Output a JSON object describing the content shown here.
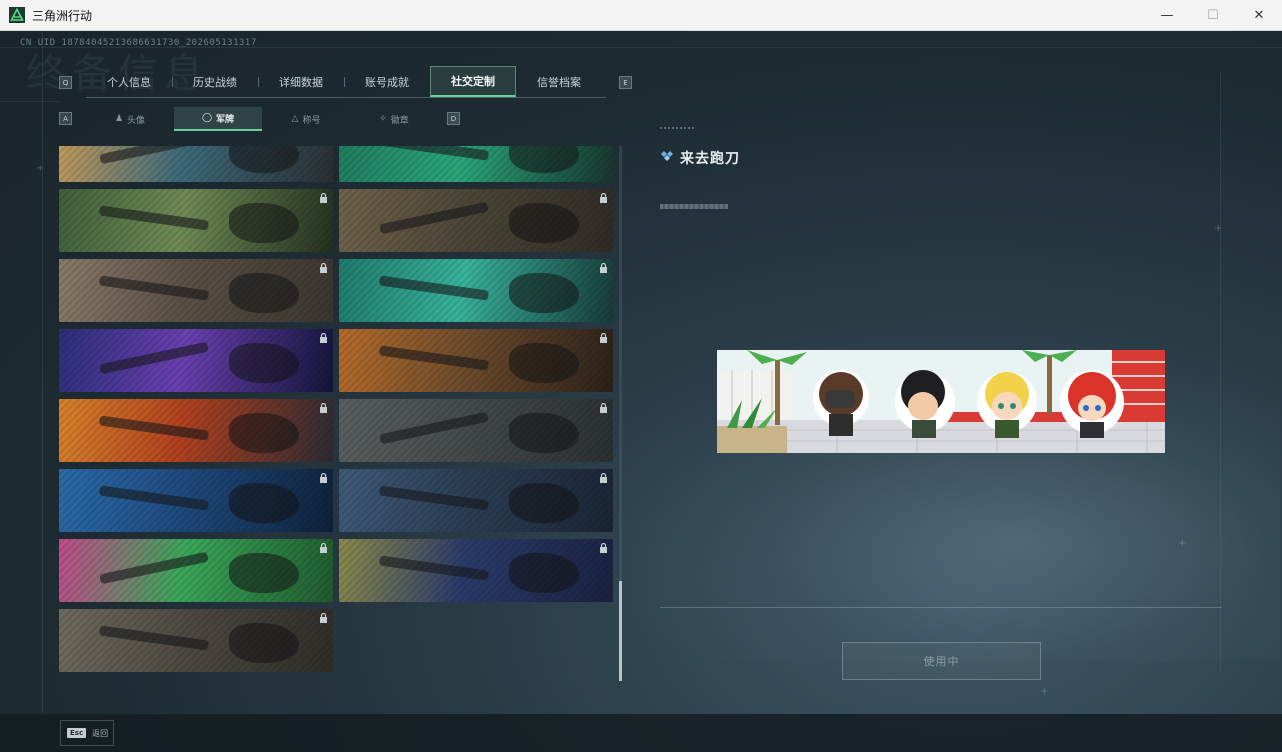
{
  "window": {
    "title": "三角洲行动",
    "minimize_glyph": "—",
    "maximize_glyph": "☐",
    "close_glyph": "✕"
  },
  "header": {
    "uid": "CN UID 18784045213686631730_202605131317",
    "ghost_title": "终备信息"
  },
  "tabs": {
    "items": [
      {
        "label": "个人信息"
      },
      {
        "label": "历史战绩"
      },
      {
        "label": "详细数据"
      },
      {
        "label": "账号成就"
      },
      {
        "label": "社交定制",
        "active": true
      },
      {
        "label": "信誉档案"
      }
    ],
    "prev_key": "Q",
    "next_key": "E"
  },
  "subtabs": {
    "items": [
      {
        "label": "头像",
        "icon": "user-icon"
      },
      {
        "label": "军牌",
        "icon": "dogtag-icon",
        "active": true
      },
      {
        "label": "称号",
        "icon": "title-icon"
      },
      {
        "label": "徽章",
        "icon": "badge-icon"
      }
    ],
    "prev_key": "A",
    "next_key": "D"
  },
  "cards": [
    {
      "name": "card-1",
      "locked": false,
      "palette": [
        "#c49a5a",
        "#3d6a7a",
        "#2a2f33"
      ]
    },
    {
      "name": "card-2",
      "locked": false,
      "palette": [
        "#1f7a5e",
        "#2aa57a",
        "#18352f"
      ]
    },
    {
      "name": "card-3",
      "locked": true,
      "palette": [
        "#3f5f3a",
        "#6f8a55",
        "#24301f"
      ]
    },
    {
      "name": "card-4",
      "locked": true,
      "palette": [
        "#6f6248",
        "#4d4638",
        "#2e2b25"
      ]
    },
    {
      "name": "card-5",
      "locked": true,
      "palette": [
        "#8a7a68",
        "#5a5046",
        "#3a352f"
      ]
    },
    {
      "name": "card-6",
      "locked": true,
      "palette": [
        "#1f7a6e",
        "#38b29a",
        "#173a38"
      ]
    },
    {
      "name": "card-7",
      "locked": true,
      "palette": [
        "#2b2f7a",
        "#6a3fb0",
        "#13163a"
      ]
    },
    {
      "name": "card-8",
      "locked": true,
      "palette": [
        "#b56b2a",
        "#6e4c2c",
        "#2a211a"
      ]
    },
    {
      "name": "card-9",
      "locked": true,
      "palette": [
        "#d6822a",
        "#b0401f",
        "#2b2a33"
      ]
    },
    {
      "name": "card-10",
      "locked": true,
      "palette": [
        "#5a5e5f",
        "#454a4c",
        "#2b2f31"
      ]
    },
    {
      "name": "card-11",
      "locked": true,
      "palette": [
        "#2a6aa8",
        "#1e4a7e",
        "#0f223a"
      ]
    },
    {
      "name": "card-12",
      "locked": true,
      "palette": [
        "#3e5a78",
        "#2c3e55",
        "#1a2535"
      ]
    },
    {
      "name": "card-13",
      "locked": true,
      "palette": [
        "#c24a8a",
        "#3aa75a",
        "#1f5a2e"
      ]
    },
    {
      "name": "card-14",
      "locked": true,
      "palette": [
        "#8a8a4a",
        "#2a3a6a",
        "#1a2240"
      ]
    },
    {
      "name": "card-15",
      "locked": true,
      "palette": [
        "#6e6a5e",
        "#4e4a42",
        "#2e2c28"
      ]
    }
  ],
  "detail": {
    "item_name": "来去跑刀",
    "use_button_label": "使用中"
  },
  "footer": {
    "esc_key": "Esc",
    "esc_label": "返回"
  },
  "colors": {
    "accent_green": "#68d09a",
    "panel_dark": "#1e2b33"
  }
}
